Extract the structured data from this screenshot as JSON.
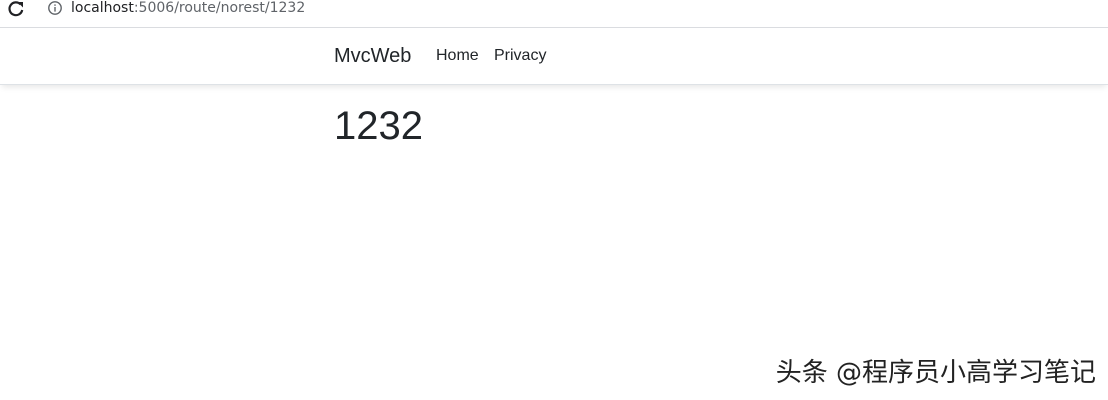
{
  "browser": {
    "url_host": "localhost",
    "url_path": ":5006/route/norest/1232",
    "icons": {
      "reload": "reload-icon",
      "site_info": "info-icon"
    }
  },
  "navbar": {
    "brand": "MvcWeb",
    "links": [
      {
        "label": "Home"
      },
      {
        "label": "Privacy"
      }
    ]
  },
  "main": {
    "heading": "1232"
  },
  "watermark": {
    "text": "头条 @程序员小高学习笔记"
  },
  "colors": {
    "text": "#212529",
    "url_path": "#5f6368",
    "navbar_border": "#dee2e6"
  }
}
